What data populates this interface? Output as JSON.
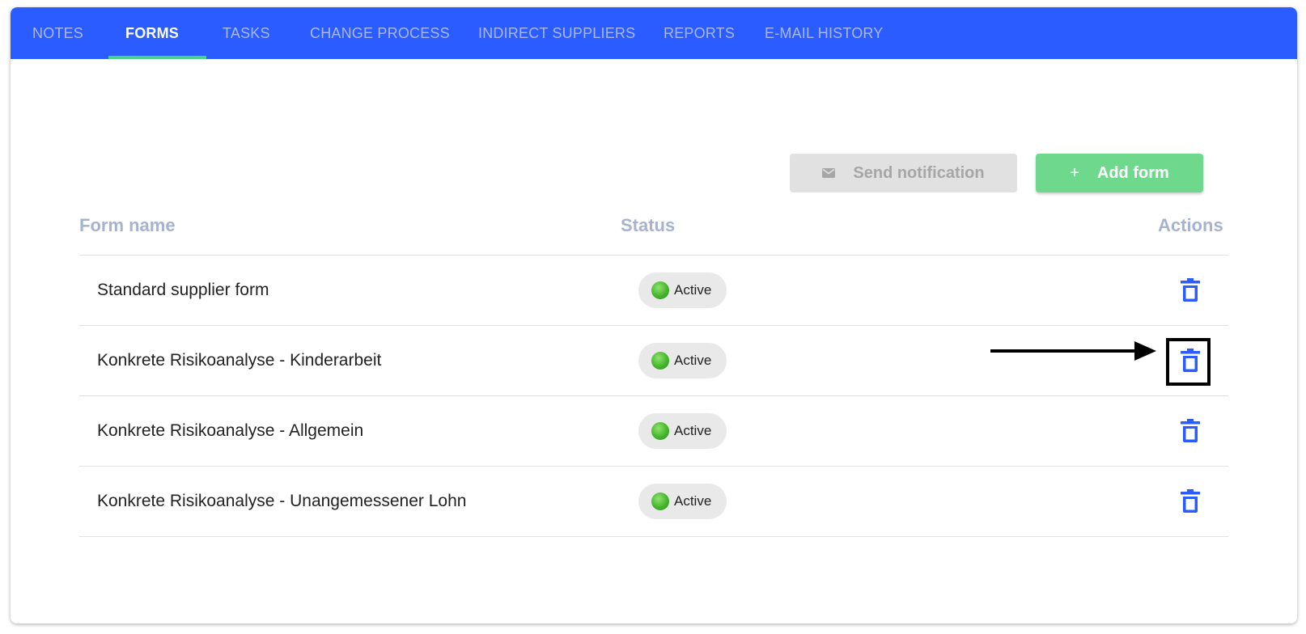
{
  "tabs": [
    {
      "label": "NOTES"
    },
    {
      "label": "FORMS"
    },
    {
      "label": "TASKS"
    },
    {
      "label": "CHANGE PROCESS"
    },
    {
      "label": "INDIRECT SUPPLIERS"
    },
    {
      "label": "REPORTS"
    },
    {
      "label": "E-MAIL HISTORY"
    }
  ],
  "active_tab": "FORMS",
  "toolbar": {
    "send_notification_label": "Send notification",
    "send_notification_icon": "envelope-icon",
    "add_form_plus": "+",
    "add_form_label": "Add form"
  },
  "table": {
    "headers": {
      "name": "Form name",
      "status": "Status",
      "actions": "Actions"
    },
    "rows": [
      {
        "name": "Standard supplier form",
        "status": "Active"
      },
      {
        "name": "Konkrete Risikoanalyse - Kinderarbeit",
        "status": "Active"
      },
      {
        "name": "Konkrete Risikoanalyse - Allgemein",
        "status": "Active"
      },
      {
        "name": "Konkrete Risikoanalyse - Unangemessener Lohn",
        "status": "Active"
      }
    ]
  },
  "annotation": {
    "target": "delete-icon of row 2",
    "marker": "arrow-with-box"
  },
  "colors": {
    "tabbar": "#2a5cff",
    "tab_indicator": "#48d189",
    "add_button": "#6ed98c",
    "disabled_button": "#e1e1e1",
    "header_text": "#a5b3cc",
    "delete_icon": "#2a5cff",
    "status_dot": "#45b52c"
  }
}
